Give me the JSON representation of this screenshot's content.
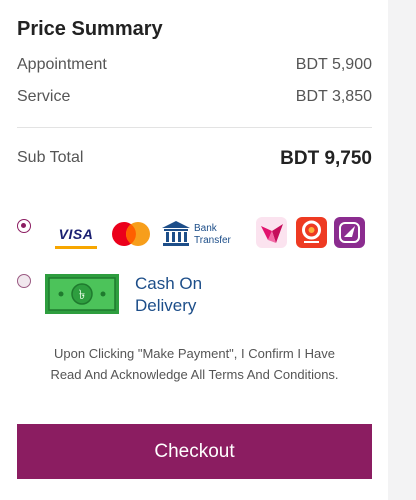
{
  "summary": {
    "title": "Price Summary",
    "items": [
      {
        "label": "Appointment",
        "value": "BDT 5,900"
      },
      {
        "label": "Service",
        "value": "BDT 3,850"
      }
    ],
    "subtotal": {
      "label": "Sub Total",
      "value": "BDT 9,750"
    }
  },
  "payment": {
    "options": [
      {
        "name": "online-payment",
        "selected": true,
        "icons": [
          "visa-icon",
          "mastercard-icon",
          "bank-transfer-icon",
          "bkash-icon",
          "nagad-icon",
          "rocket-icon"
        ],
        "visa_text": "VISA",
        "bank_text_line1": "Bank",
        "bank_text_line2": "Transfer"
      },
      {
        "name": "cash-on-delivery",
        "selected": false,
        "label_line1": "Cash On",
        "label_line2": "Delivery"
      }
    ]
  },
  "terms": {
    "line1": "Upon Clicking \"Make Payment\", I Confirm I Have",
    "line2": "Read And Acknowledge All Terms And Conditions."
  },
  "checkout": {
    "label": "Checkout"
  },
  "colors": {
    "accent": "#8b1d61",
    "link_blue": "#1d4e89"
  }
}
